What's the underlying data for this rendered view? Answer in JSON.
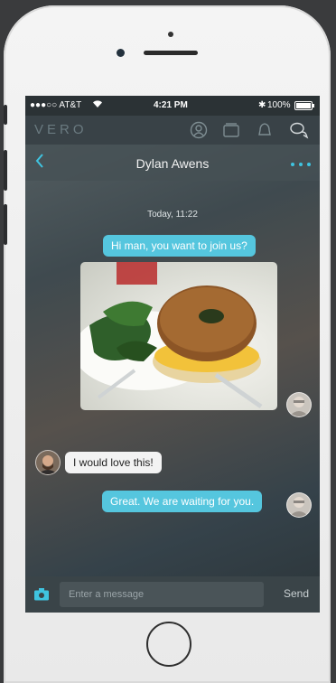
{
  "status_bar": {
    "carrier": "●●●○○ AT&T",
    "time": "4:21 PM",
    "battery": "100%"
  },
  "app": {
    "logo": "VERO",
    "nav_icons": [
      "profile-icon",
      "collections-icon",
      "notifications-icon",
      "chat-icon"
    ]
  },
  "conversation": {
    "back_icon": "chevron-left-icon",
    "contact_name": "Dylan Awens",
    "more_icon": "ellipsis-icon",
    "date_label": "Today, 11:22",
    "messages": [
      {
        "direction": "outgoing",
        "text": "Hi man, you want to join us?"
      },
      {
        "direction": "outgoing",
        "type": "photo",
        "description_icon": "bagel-photo"
      },
      {
        "direction": "incoming",
        "text": "I would love this!"
      },
      {
        "direction": "outgoing",
        "text": "Great. We are waiting for you."
      }
    ]
  },
  "composer": {
    "camera_icon": "camera-icon",
    "placeholder": "Enter a message",
    "send_label": "Send"
  },
  "colors": {
    "accent": "#3fc4e0",
    "outgoing_bubble": "#55c6de",
    "incoming_bubble": "#f3f3f3"
  }
}
